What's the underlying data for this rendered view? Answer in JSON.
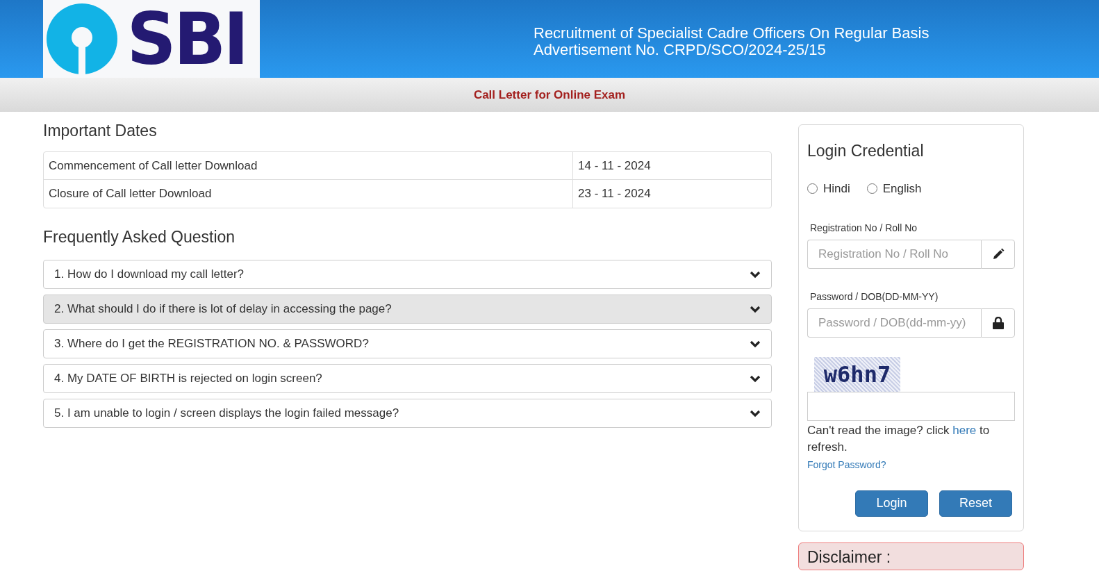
{
  "header": {
    "logo_text": "SBI",
    "title_lines": [
      "Recruitment of Specialist Cadre Officers On Regular Basis",
      "Advertisement No. CRPD/SCO/2024-25/15"
    ]
  },
  "subheader": {
    "title": "Call Letter for Online Exam"
  },
  "important_dates": {
    "heading": "Important Dates",
    "rows": [
      {
        "label": "Commencement of Call letter Download",
        "date": "14 - 11 - 2024"
      },
      {
        "label": "Closure of Call letter Download",
        "date": "23 - 11 - 2024"
      }
    ]
  },
  "faq": {
    "heading": "Frequently Asked Question",
    "items": [
      {
        "question": "1. How do I download my call letter?",
        "selected": false,
        "expanded": false
      },
      {
        "question": "2. What should I do if there is lot of delay in accessing the page?",
        "selected": true,
        "expanded": false
      },
      {
        "question": "3. Where do I get the REGISTRATION NO. & PASSWORD?",
        "selected": false,
        "expanded": false
      },
      {
        "question": "4. My DATE OF BIRTH is rejected on login screen?",
        "selected": false,
        "expanded": false
      },
      {
        "question": "5. I am unable to login / screen displays the login failed message?",
        "selected": false,
        "expanded": false
      }
    ]
  },
  "login": {
    "heading": "Login Credential",
    "languages": [
      {
        "label": "Hindi",
        "selected": false
      },
      {
        "label": "English",
        "selected": false
      }
    ],
    "fields": [
      {
        "label": "Registration No / Roll No",
        "placeholder": "Registration No / Roll No",
        "kind": "pencil"
      },
      {
        "label": "Password / DOB(DD-MM-YY)",
        "placeholder": "Password / DOB(dd-mm-yy)",
        "kind": "lock"
      }
    ],
    "captcha_text": "w6hn7",
    "refresh_before": "Can't read the image? click ",
    "refresh_link": "here",
    "refresh_after": " to refresh.",
    "forgot_link": "Forgot Password?",
    "buttons": [
      "Login",
      "Reset"
    ]
  },
  "disclaimer": {
    "heading": "Disclaimer :"
  }
}
